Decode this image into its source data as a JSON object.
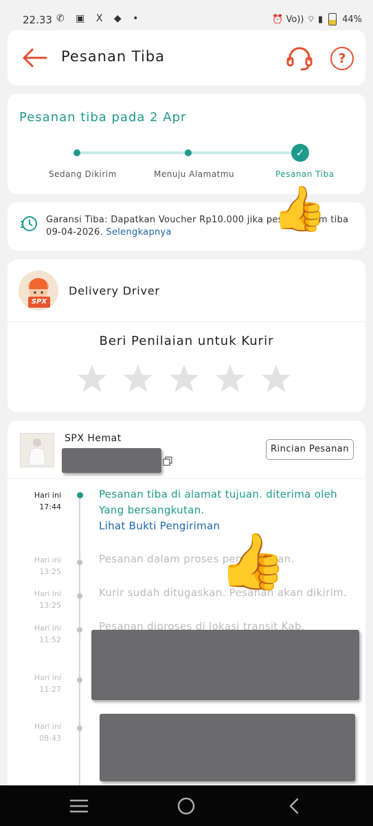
{
  "status_bar": {
    "time": "22.33",
    "left_icons": "✆ ▣ X ◆ •",
    "battery": "44%",
    "right_icons": "⏰ Vo)) ⌔ ▮"
  },
  "header": {
    "title": "Pesanan Tiba"
  },
  "progress": {
    "title": "Pesanan tiba pada 2 Apr",
    "steps": [
      "Sedang Dikirim",
      "Menuju Alamatmu",
      "Pesanan Tiba"
    ],
    "fraction_complete": 1.0
  },
  "guarantee": {
    "text_prefix": "Garansi Tiba: Dapatkan Voucher Rp10.000 jika pes",
    "text_suffix": "m tiba",
    "text_line2": "09-04-2026.",
    "link": "Selengkapnya"
  },
  "driver": {
    "name": "Delivery Driver",
    "badge": "SPX",
    "rating_title": "Beri Penilaian untuk Kurir",
    "stars_total": 5,
    "stars_filled": 0
  },
  "shipping": {
    "courier": "SPX Hemat",
    "details_button": "Rincian Pesanan",
    "timeline": [
      {
        "day": "Hari ini",
        "time": "17:44",
        "line1": "Pesanan tiba di alamat tujuan. diterima oleh",
        "line2": "Yang bersangkutan.",
        "link": "Lihat Bukti Pengiriman"
      },
      {
        "day": "Hari ini",
        "time": "13:25",
        "line1": "Pesanan dalam proses pengantaran."
      },
      {
        "day": "Hari ini",
        "time": "13:25",
        "line1": "Kurir sudah ditugaskan. Pesanan akan dikirim."
      },
      {
        "day": "Hari ini",
        "time": "11:52",
        "line1": "Pesanan diproses di lokasi transit Kab."
      },
      {
        "day": "Hari ini",
        "time": "11:27"
      },
      {
        "day": "Hari ini",
        "time": "08:43"
      }
    ]
  },
  "colors": {
    "accent": "#e0502f",
    "teal": "#1f9a8a",
    "link": "#1d65a8"
  },
  "icons": {
    "back": "arrow-left-icon",
    "support": "headset-icon",
    "help": "question-icon",
    "guarantee": "clock-speed-icon",
    "copy": "copy-icon",
    "star": "star-icon",
    "thumbs_up": "thumbs-up-emoji",
    "nav_menu": "menu-icon",
    "nav_home": "home-circle-icon",
    "nav_back": "chevron-left-icon"
  }
}
